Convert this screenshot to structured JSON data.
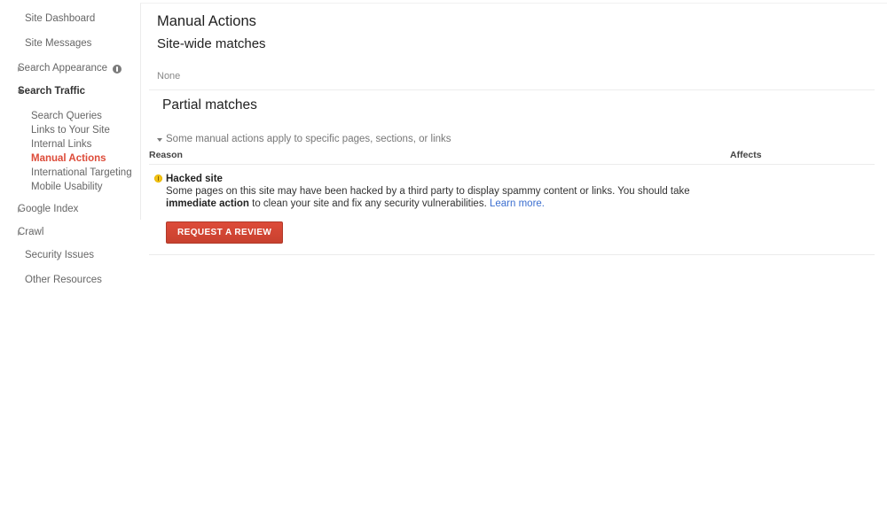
{
  "sidebar": {
    "items": [
      {
        "label": "Site Dashboard",
        "type": "top",
        "icon": null
      },
      {
        "label": "Site Messages",
        "type": "top",
        "icon": null
      },
      {
        "label": "Search Appearance",
        "type": "group",
        "state": "collapsed",
        "icon": "info-icon"
      },
      {
        "label": "Search Traffic",
        "type": "group",
        "state": "expanded",
        "icon": null
      },
      {
        "label": "Search Queries",
        "type": "child",
        "active": false
      },
      {
        "label": "Links to Your Site",
        "type": "child",
        "active": false
      },
      {
        "label": "Internal Links",
        "type": "child",
        "active": false
      },
      {
        "label": "Manual Actions",
        "type": "child",
        "active": true
      },
      {
        "label": "International Targeting",
        "type": "child",
        "active": false
      },
      {
        "label": "Mobile Usability",
        "type": "child",
        "active": false
      },
      {
        "label": "Google Index",
        "type": "group",
        "state": "collapsed",
        "icon": null
      },
      {
        "label": "Crawl",
        "type": "group",
        "state": "collapsed",
        "icon": null
      },
      {
        "label": "Security Issues",
        "type": "tail",
        "icon": null
      },
      {
        "label": "Other Resources",
        "type": "tail",
        "icon": null
      }
    ]
  },
  "main": {
    "title": "Manual Actions",
    "subtitle": "Site-wide matches",
    "sitewide_value": "None",
    "partial_section_title": "Partial matches",
    "collapse_note": "Some manual actions apply to specific pages, sections, or links",
    "table": {
      "headers": {
        "reason": "Reason",
        "affects": "Affects"
      },
      "rows": [
        {
          "icon": "warning-icon",
          "title": "Hacked site",
          "desc_part1": "Some pages on this site may have been hacked by a third party to display spammy content or links. You should take ",
          "desc_bold": "immediate action",
          "desc_part2": " to clean your site and fix any security vulnerabilities. ",
          "link": "Learn more.",
          "affects": ""
        }
      ]
    },
    "request_review_label": "Request a review"
  },
  "colors": {
    "active_nav": "#dd4b39",
    "button": "#d14836",
    "link": "#3c6fd0",
    "warning": "#f5c518",
    "rule": "#ececec"
  }
}
